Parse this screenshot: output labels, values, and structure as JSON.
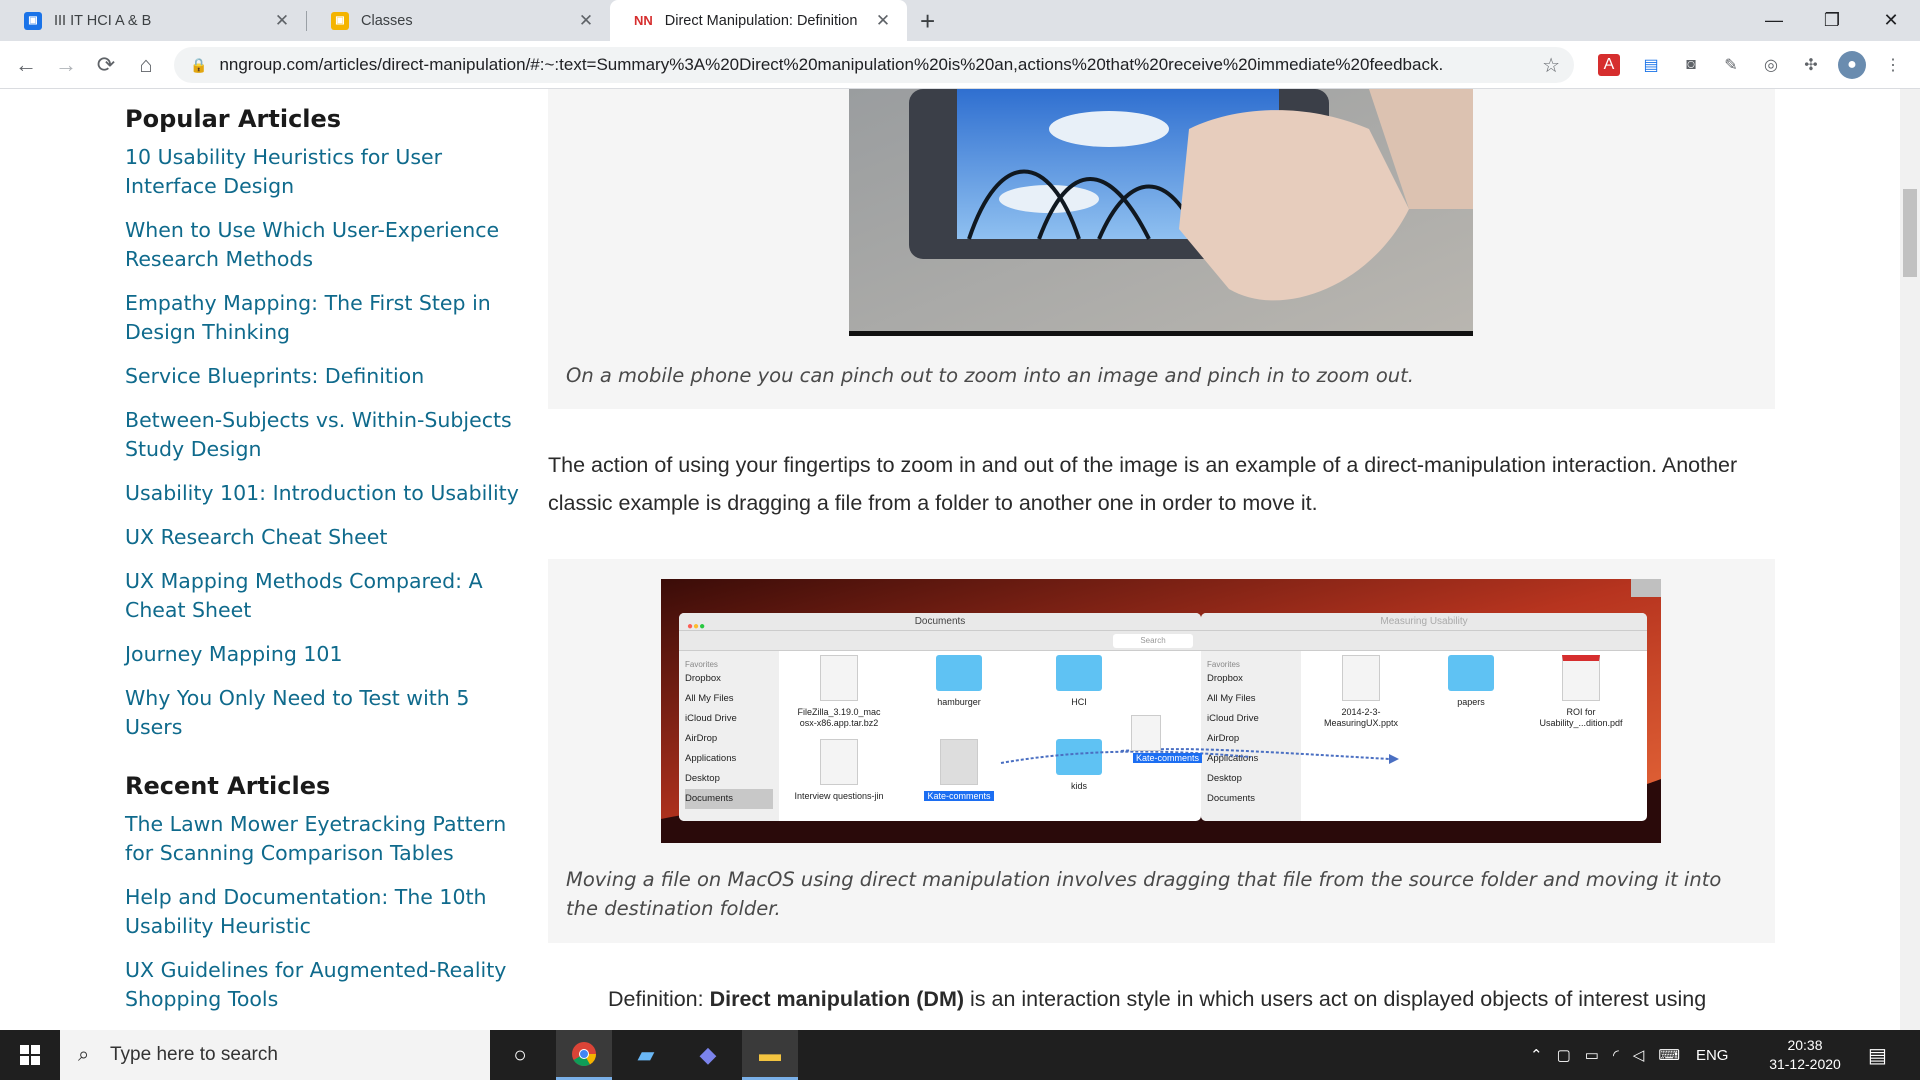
{
  "browser": {
    "tabs": [
      {
        "label": "III IT HCI A & B",
        "favicon_color": "#1a73e8",
        "active": false
      },
      {
        "label": "Classes",
        "favicon_color": "#f4b400",
        "active": false
      },
      {
        "label": "Direct Manipulation: Definition",
        "favicon_text": "NN",
        "favicon_color": "#d62e2e",
        "active": true
      }
    ],
    "url": "nngroup.com/articles/direct-manipulation/#:~:text=Summary%3A%20Direct%20manipulation%20is%20an,actions%20that%20receive%20immediate%20feedback.",
    "icons": {
      "back": "←",
      "forward": "→",
      "reload": "⟳",
      "home": "⌂",
      "star": "☆",
      "new_tab": "+",
      "minimize": "—",
      "restore": "❐",
      "close": "✕"
    }
  },
  "sidebar": {
    "popular_heading": "Popular Articles",
    "popular": [
      "10 Usability Heuristics for User Interface Design",
      "When to Use Which User-Experience Research Methods",
      "Empathy Mapping: The First Step in Design Thinking",
      "Service Blueprints: Definition",
      "Between-Subjects vs. Within-Subjects Study Design",
      "Usability 101: Introduction to Usability",
      "UX Research Cheat Sheet",
      "UX Mapping Methods Compared: A Cheat Sheet",
      "Journey Mapping 101",
      "Why You Only Need to Test with 5 Users"
    ],
    "recent_heading": "Recent Articles",
    "recent": [
      "The Lawn Mower Eyetracking Pattern for Scanning Comparison Tables",
      "Help and Documentation: The 10th Usability Heuristic",
      "UX Guidelines for Augmented-Reality Shopping Tools"
    ]
  },
  "article": {
    "caption1": "On a mobile phone you can pinch out to zoom into an image and pinch in to zoom out.",
    "paragraph1": "The action of using your fingertips to zoom in and out of the image is an example of a direct-manipulation interaction. Another classic example is dragging a file from a folder to another one in order to move it.",
    "caption2": "Moving a file on MacOS using direct manipulation involves dragging that file from the source folder and moving it into the destination folder.",
    "definition_prefix": "Definition: ",
    "definition_bold": "Direct manipulation (DM)",
    "definition_rest": " is an interaction style in which users act on displayed objects of interest using"
  },
  "finder_left": {
    "title": "Documents",
    "search": "Search",
    "favorites_label": "Favorites",
    "sidebar_items": [
      "Dropbox",
      "All My Files",
      "iCloud Drive",
      "AirDrop",
      "Applications",
      "Desktop",
      "Documents"
    ],
    "files": [
      {
        "name": "FileZilla_3.19.0_mac osx-x86.app.tar.bz2",
        "kind": "doc"
      },
      {
        "name": "hamburger",
        "kind": "folder"
      },
      {
        "name": "HCI",
        "kind": "folder"
      },
      {
        "name": "Interview questions-jin",
        "kind": "doc"
      },
      {
        "name": "Kate-comments",
        "kind": "doc"
      },
      {
        "name": "kids",
        "kind": "folder"
      }
    ]
  },
  "finder_right": {
    "title": "Measuring Usability",
    "favorites_label": "Favorites",
    "sidebar_items": [
      "Dropbox",
      "All My Files",
      "iCloud Drive",
      "AirDrop",
      "Applications",
      "Desktop",
      "Documents"
    ],
    "files": [
      {
        "name": "2014-2-3-MeasuringUX.pptx",
        "kind": "doc"
      },
      {
        "name": "papers",
        "kind": "folder"
      },
      {
        "name": "ROI for Usability_...dition.pdf",
        "kind": "doc"
      }
    ],
    "drag_label": "Kate-comments"
  },
  "taskbar": {
    "search_placeholder": "Type here to search",
    "language": "ENG",
    "time": "20:38",
    "date": "31-12-2020"
  }
}
